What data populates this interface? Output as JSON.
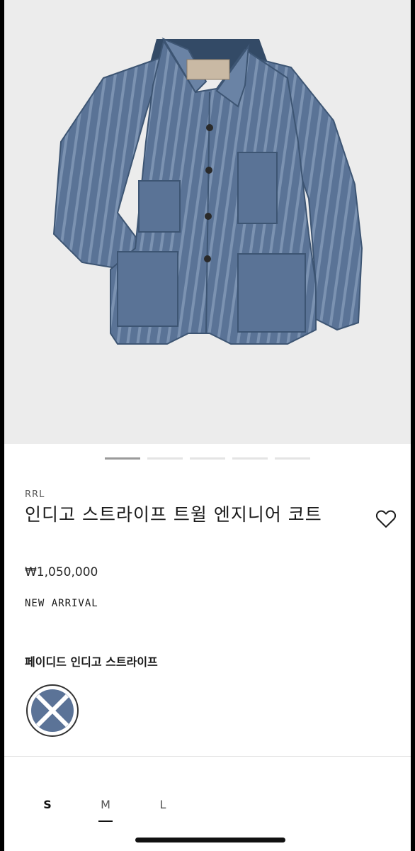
{
  "product": {
    "brand": "RRL",
    "title": "인디고 스트라이프 트윌 엔지니어 코트",
    "price": "₩1,050,000",
    "badge": "NEW ARRIVAL",
    "color_name": "페이디드 인디고 스트라이프",
    "image_icon": "denim-jacket-image",
    "favorite_icon": "heart-icon"
  },
  "gallery": {
    "image_count": 5,
    "active_index": 0
  },
  "sizes": {
    "options": [
      "S",
      "M",
      "L"
    ],
    "selected": "M"
  },
  "colors": {
    "denim": "#4d6788",
    "background": "#ececec",
    "accent": "#111111"
  }
}
